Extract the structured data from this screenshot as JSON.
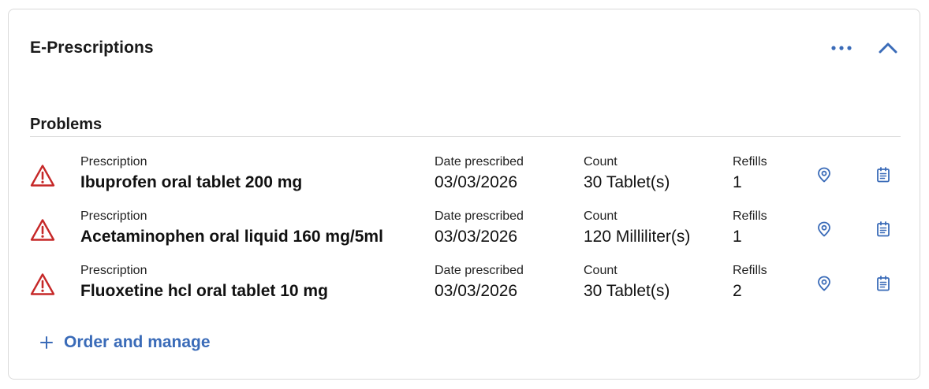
{
  "card": {
    "title": "E-Prescriptions",
    "more_icon": "more-horizontal-icon",
    "collapse_icon": "chevron-up-icon"
  },
  "section": {
    "title": "Problems"
  },
  "columns": {
    "prescription": "Prescription",
    "date": "Date prescribed",
    "count": "Count",
    "refills": "Refills"
  },
  "prescriptions": [
    {
      "name": "Ibuprofen oral tablet 200 mg",
      "date": "03/03/2026",
      "count": "30 Tablet(s)",
      "refills": "1"
    },
    {
      "name": "Acetaminophen oral liquid 160 mg/5ml",
      "date": "03/03/2026",
      "count": "120 Milliliter(s)",
      "refills": "1"
    },
    {
      "name": "Fluoxetine hcl oral tablet 10 mg",
      "date": "03/03/2026",
      "count": "30 Tablet(s)",
      "refills": "2"
    }
  ],
  "footer": {
    "order_label": "Order and manage"
  },
  "colors": {
    "accent": "#3a6bb8",
    "warning": "#c62828",
    "border": "#d9d9d9"
  }
}
